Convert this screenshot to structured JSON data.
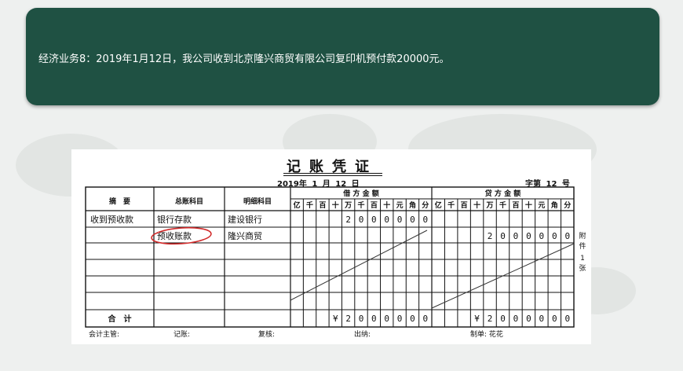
{
  "banner": {
    "text": "经济业务8：2019年1月12日，我公司收到北京隆兴商贸有限公司复印机预付款20000元。"
  },
  "voucher": {
    "title": "记账凭证",
    "date": "2019年 1 月 12 日",
    "number": "字第 12 号",
    "headers": {
      "summary": "摘　要",
      "general_account": "总账科目",
      "detail_account": "明细科目",
      "debit": "借 方 金 额",
      "credit": "贷 方 金 额"
    },
    "digit_headers": [
      "亿",
      "千",
      "百",
      "十",
      "万",
      "千",
      "百",
      "十",
      "元",
      "角",
      "分"
    ],
    "rows": [
      {
        "summary": "收到预收款",
        "general": "银行存款",
        "detail": "建设银行",
        "debit": "2000000",
        "credit": ""
      },
      {
        "summary": "",
        "general": "预收账款",
        "detail": "隆兴商贸",
        "debit": "",
        "credit": "2000000"
      }
    ],
    "total": {
      "label": "合　计",
      "debit": "¥2000000",
      "credit": "¥2000000"
    },
    "attachment": [
      "附",
      "件",
      "1",
      "张"
    ],
    "footer": {
      "supervisor": "会计主管:",
      "bookkeeper": "记账:",
      "reviewer": "复核:",
      "cashier": "出纳:",
      "preparer": "制单: 花花"
    },
    "annotation_color": "#d12a2a"
  }
}
